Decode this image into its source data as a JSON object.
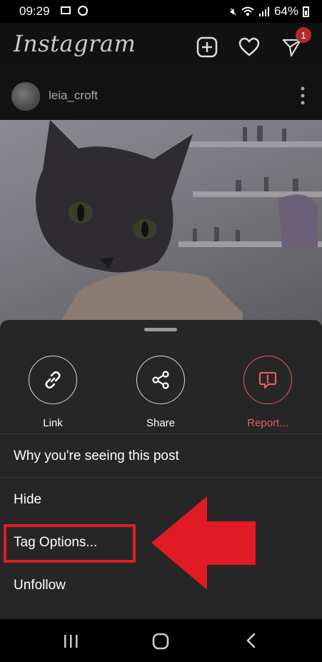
{
  "status_bar": {
    "time": "09:29",
    "battery": "64%"
  },
  "app_bar": {
    "logo": "Instagram",
    "notification_count": "1"
  },
  "post": {
    "username": "leia_croft"
  },
  "sheet": {
    "actions": [
      {
        "label": "Link",
        "icon": "link-icon"
      },
      {
        "label": "Share",
        "icon": "share-icon"
      },
      {
        "label": "Report...",
        "icon": "report-icon",
        "color": "#e35e63"
      }
    ],
    "menu": [
      "Why you're seeing this post",
      "Hide",
      "Tag Options...",
      "Unfollow"
    ]
  },
  "annotation": {
    "color": "#e01b24"
  }
}
